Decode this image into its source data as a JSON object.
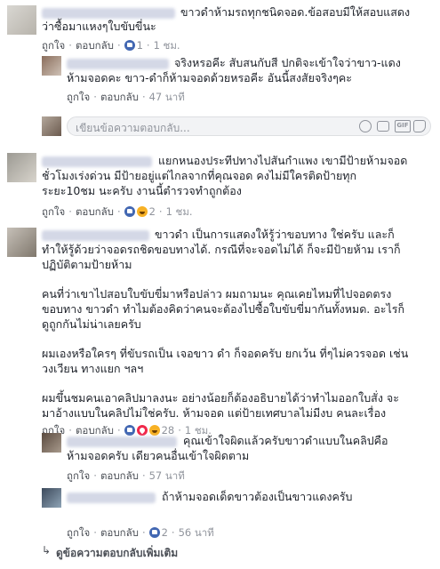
{
  "comments": [
    {
      "text_lines": [
        "ขาวดำห้ามรถทุกชนิดจอด.ข้อสอบมีให้สอบแสดง",
        "ว่าซื้อมาแหงๆใบขับขี่นะ"
      ],
      "like_label": "ถูกใจ",
      "reply_label": "ตอบกลับ",
      "reactions": [
        "like"
      ],
      "reaction_count": "1",
      "time": "1 ชม."
    },
    {
      "text_lines": [
        "จริงหรอคีะ สับสนกับสี ปกติจะเข้าใจว่าขาว-แดง",
        "ห้ามจอดคะ ขาว-ดำก็ห้ามจอดด้วยหรอคีะ อันนี้สงสัยจริงๆคะ"
      ],
      "like_label": "ถูกใจ",
      "reply_label": "ตอบกลับ",
      "time": "47 นาที"
    },
    {
      "text_lines": [
        "แยกหนองประทีปทางไปสันกำแพง เขามีป้ายห้ามจอด",
        "ชั่วโมงเร่งด่วน มีป้ายอยู่แต่ไกลจากที่คุณจอด คงไม่มีใครติดป้ายทุก",
        "ระยะ10ชม นะครับ งานนี้ตำรวจทำถูกต้อง"
      ],
      "like_label": "ถูกใจ",
      "reply_label": "ตอบกลับ",
      "reactions": [
        "like",
        "haha"
      ],
      "reaction_count": "2",
      "time": "1 ชม."
    },
    {
      "paragraphs": [
        [
          "ขาวดำ เป็นการแสดงให้รู้ว่าขอบทาง ใช่ครับ และก็",
          "ทำให้รู้ด้วยว่าจอดรถชิดขอบทางได้. กรณีที่จะจอดไม่ได้ ก็จะมีป้ายห้าม เราก็",
          "ปฏิบัติตามป้ายห้าม"
        ],
        [
          "คนที่ว่าเขาไปสอบใบขับขี่มาหรือปล่าว ผมถามนะ คุณเคยไหมที่ไปจอดตรง",
          "ขอบทาง ขาวดำ ทำไมต้องคิดว่าคนจะต้องไปซื้อใบขับขี่มากันทั้งหมด. อะไรก็",
          "ดูถูกกันไม่น่าเลยครับ"
        ],
        [
          "ผมเองหรือใครๆ ที่ขับรถเป็น เจอขาว ดำ ก็จอดครับ ยกเว้น ที่ๆไม่ควรจอด เช่น",
          "วงเวียน ทางแยก ฯลฯ"
        ],
        [
          "ผมขึ้นชมคนเอาคลิปมาลงนะ อย่างน้อยก็ต้องอธิบายได้ว่าทำไมออกใบสั่ง จะ",
          "มาอ้างแบบในคลิปไม่ใช่ครับ. ห้ามจอด แต่ป้ายเทศบาลไม่มีงบ คนละเรื่อง"
        ]
      ],
      "like_label": "ถูกใจ",
      "reply_label": "ตอบกลับ",
      "reactions": [
        "like",
        "love",
        "haha"
      ],
      "reaction_count": "28",
      "time": "1 ชม."
    },
    {
      "text_lines": [
        "คุณเข้าใจผิดแล้วครับขาวดำแบบในคลิปคือ",
        "ห้ามจอดครับ เดียวคนอื่นเข้าใจผิดตาม"
      ],
      "like_label": "ถูกใจ",
      "reply_label": "ตอบกลับ",
      "time": "57 นาที"
    },
    {
      "text_lines": [
        "ถ้าห้ามจอดเด็ดขาวต้องเป็นขาวแดงครับ"
      ],
      "like_label": "ถูกใจ",
      "reply_label": "ตอบกลับ",
      "reactions": [
        "like"
      ],
      "reaction_count": "2",
      "time": "56 นาที"
    }
  ],
  "reply_box": {
    "placeholder": "เขียนข้อความตอบกลับ..."
  },
  "more_replies": "ดูข้อความตอบกลับเพิ่มเติม",
  "icons": [
    "emoji-icon",
    "camera-icon",
    "gif-icon",
    "sticker-icon",
    "like-reaction-icon",
    "love-reaction-icon",
    "haha-reaction-icon",
    "reply-arrow-icon"
  ],
  "colors": {
    "link": "#4b4f56",
    "meta": "#90949c",
    "like": "#4267b2",
    "love": "#f0284a",
    "haha": "#f7b125"
  }
}
